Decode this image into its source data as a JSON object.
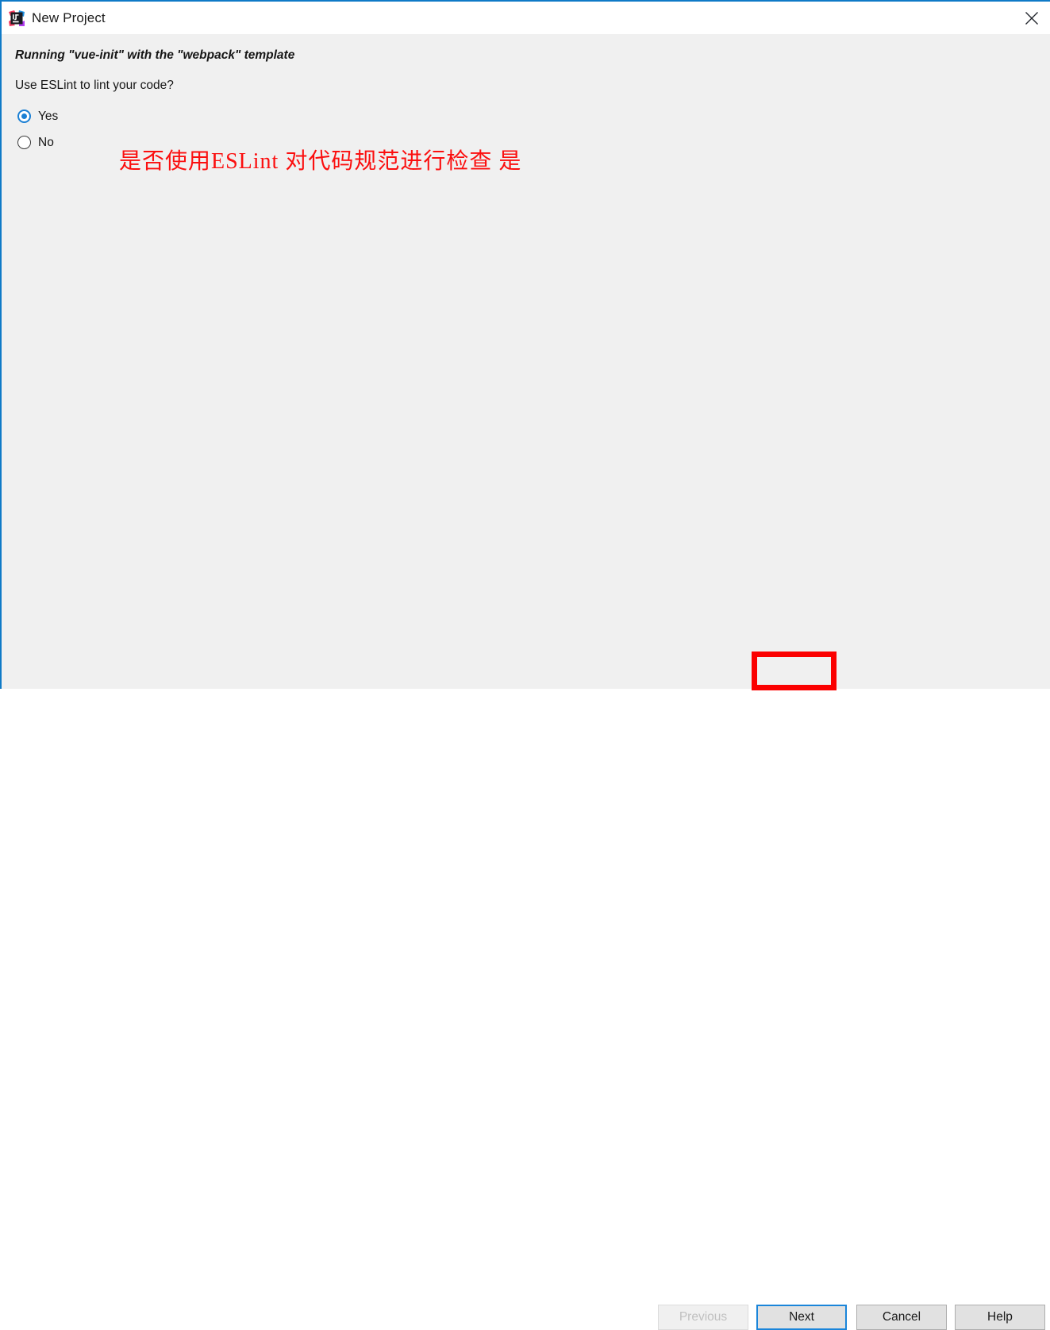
{
  "window": {
    "title": "New Project",
    "icon": "intellij-idea-logo",
    "accent_border_color": "#0f7ac7",
    "titlebar_bg": "#ffffff",
    "content_bg": "#f0f0f0",
    "close_icon": "close-icon"
  },
  "content": {
    "running_text": "Running \"vue-init\" with the \"webpack\" template",
    "question_text": "Use ESLint to lint your code?",
    "options": [
      {
        "label": "Yes",
        "selected": true
      },
      {
        "label": "No",
        "selected": false
      }
    ],
    "annotation": {
      "text": "是否使用ESLint 对代码规范进行检查 是",
      "color": "#fb0f0f"
    }
  },
  "footer": {
    "buttons": [
      {
        "label": "Previous",
        "state": "disabled"
      },
      {
        "label": "Next",
        "state": "focused"
      },
      {
        "label": "Cancel",
        "state": "normal"
      },
      {
        "label": "Help",
        "state": "normal"
      }
    ],
    "highlight_color": "#fb0000",
    "focus_color": "#1a85da"
  }
}
